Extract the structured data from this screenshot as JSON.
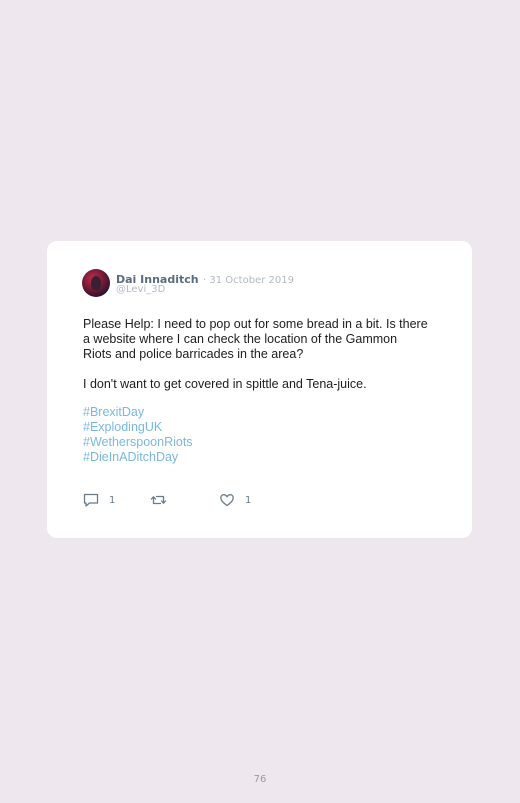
{
  "tweet": {
    "author_name": "Dai Innaditch",
    "date": "· 31 October 2019",
    "handle": "@Levi_3D",
    "paragraphs": [
      "Please Help: I need to pop out for some bread in a bit. Is there a website where I can check the location of the Gammon Riots and police barricades in the area?",
      "I don't want to get covered in spittle and Tena-juice."
    ],
    "hashtags": [
      "#BrexitDay",
      "#ExplodingUK",
      "#WetherspoonRiots",
      "#DieInADitchDay"
    ],
    "actions": {
      "reply": {
        "icon": "comment-icon",
        "count": "1"
      },
      "retweet": {
        "icon": "retweet-icon",
        "count": ""
      },
      "like": {
        "icon": "heart-icon",
        "count": "1"
      }
    }
  },
  "colors": {
    "background": "#efe7ee",
    "card": "#ffffff",
    "hashtag": "#7ab8e2",
    "author": "#5a6c7c"
  },
  "page_number": "76"
}
